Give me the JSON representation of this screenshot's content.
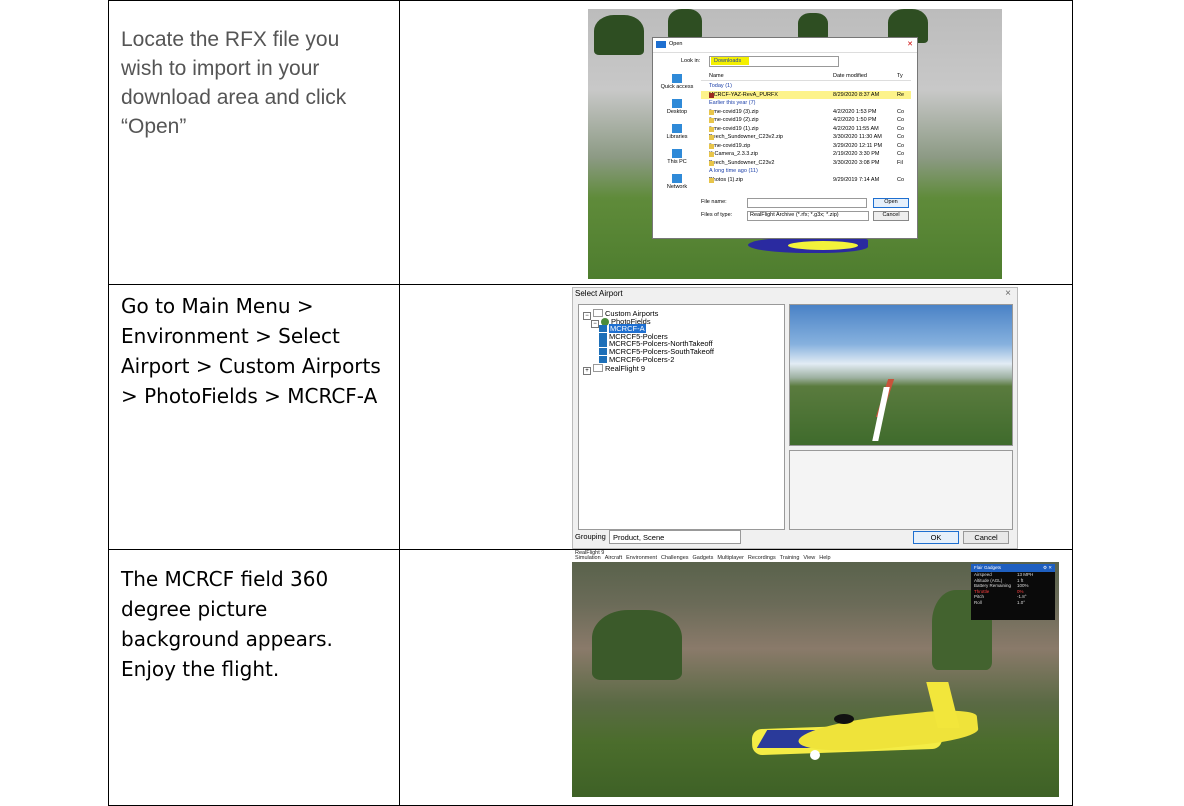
{
  "rows": [
    {
      "text": "Locate the RFX file you wish to import in your download area and click “Open”",
      "screenshot": {
        "dialog_title": "Open",
        "look_in_label": "Look in:",
        "look_in_value": "Downloads",
        "places": [
          "Quick access",
          "Desktop",
          "Libraries",
          "This PC",
          "Network"
        ],
        "columns": [
          "Name",
          "Date modified",
          "Ty"
        ],
        "files": [
          {
            "name": "Today (1)",
            "date": "",
            "type": "",
            "group": true
          },
          {
            "name": "MCRCF-YAZ-RevA_PURFX",
            "date": "8/29/2020 8:37 AM",
            "type": "Re",
            "selected": true
          },
          {
            "name": "Earlier this year (7)",
            "date": "",
            "type": "",
            "group": true
          },
          {
            "name": "ihme-covid19 (3).zip",
            "date": "4/2/2020 1:53 PM",
            "type": "Co"
          },
          {
            "name": "ihme-covid19 (2).zip",
            "date": "4/2/2020 1:50 PM",
            "type": "Co"
          },
          {
            "name": "ihme-covid19 (1).zip",
            "date": "4/2/2020 11:55 AM",
            "type": "Co"
          },
          {
            "name": "Beech_Sundowner_C23v2.zip",
            "date": "3/30/2020 11:30 AM",
            "type": "Co"
          },
          {
            "name": "ihme-covid19.zip",
            "date": "3/29/2020 12:11 PM",
            "type": "Co"
          },
          {
            "name": "X-Camera_2.3.3.zip",
            "date": "2/19/2020 3:30 PM",
            "type": "Co"
          },
          {
            "name": "Beech_Sundowner_C23v2",
            "date": "3/30/2020 3:08 PM",
            "type": "Fil"
          },
          {
            "name": "A long time ago (11)",
            "date": "",
            "type": "",
            "group": true
          },
          {
            "name": "Photos (1).zip",
            "date": "9/29/2019 7:14 AM",
            "type": "Co"
          }
        ],
        "file_name_label": "File name:",
        "file_name_value": "",
        "files_of_type_label": "Files of type:",
        "files_of_type_value": "RealFlight Archive (*.rfx; *.g3x; *.zip)",
        "open_button": "Open",
        "cancel_button": "Cancel"
      }
    },
    {
      "text": "Go to Main Menu > Environment > Select Airport > Custom Airports > PhotoFields > MCRCF-A",
      "screenshot": {
        "dialog_title": "Select Airport",
        "close": "×",
        "tree": [
          {
            "label": "Custom Airports",
            "level": 0,
            "icon": "folder"
          },
          {
            "label": "PhotoFields",
            "level": 1,
            "icon": "globe"
          },
          {
            "label": "MCRCF-A",
            "level": 2,
            "icon": "airport",
            "selected": true
          },
          {
            "label": "MCRCF5-Polcers",
            "level": 2,
            "icon": "airport"
          },
          {
            "label": "MCRCF5-Polcers-NorthTakeoff",
            "level": 2,
            "icon": "airport"
          },
          {
            "label": "MCRCF5-Polcers-SouthTakeoff",
            "level": 2,
            "icon": "airport"
          },
          {
            "label": "MCRCF6-Polcers-2",
            "level": 2,
            "icon": "airport"
          },
          {
            "label": "RealFlight 9",
            "level": 0,
            "icon": "folder"
          }
        ],
        "grouping_label": "Grouping",
        "grouping_value": "Product, Scene",
        "ok_button": "OK",
        "cancel_button": "Cancel"
      }
    },
    {
      "text": "The MCRCF field 360 degree picture background appears. Enjoy the flight.",
      "screenshot": {
        "app_title": "RealFlight 9",
        "menu": [
          "Simulation",
          "Aircraft",
          "Environment",
          "Challenges",
          "Gadgets",
          "Multiplayer",
          "Recordings",
          "Training",
          "View",
          "Help"
        ],
        "panel_title": "Flair Gadgets",
        "panel_rows": [
          {
            "k": "Airspeed",
            "v": "13 MPH"
          },
          {
            "k": "Altitude (AGL)",
            "v": "1 ft"
          },
          {
            "k": "Battery Remaining",
            "v": "100%"
          },
          {
            "k": "Throttle",
            "v": "0%",
            "warn": true
          },
          {
            "k": "Pitch",
            "v": "-1.8°"
          },
          {
            "k": "Roll",
            "v": "1.0°"
          }
        ]
      }
    }
  ]
}
